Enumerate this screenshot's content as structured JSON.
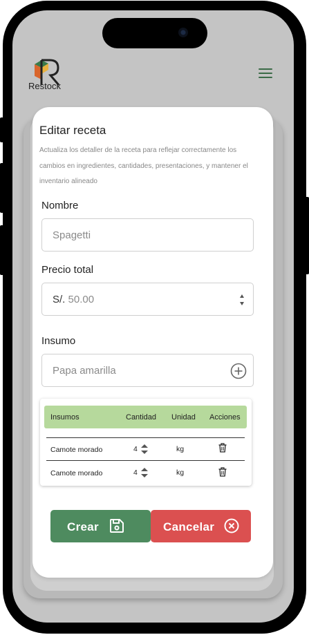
{
  "app": {
    "name": "Restock"
  },
  "form": {
    "title": "Editar receta",
    "description": "Actualiza los detaller de la receta para reflejar correctamente los cambios en ingredientes, cantidades, presentaciones, y mantener el inventario alineado",
    "name_label": "Nombre",
    "name_value": "Spagetti",
    "price_label": "Precio total",
    "price_prefix": "S/.",
    "price_value": "50.00",
    "supply_label": "Insumo",
    "supply_placeholder": "Papa amarilla"
  },
  "table": {
    "headers": {
      "supply": "Insumos",
      "quantity": "Cantidad",
      "unit": "Unidad",
      "actions": "Acciones"
    },
    "rows": [
      {
        "supply": "Camote morado",
        "quantity": "4",
        "unit": "kg"
      },
      {
        "supply": "Camote morado",
        "quantity": "4",
        "unit": "kg"
      }
    ]
  },
  "buttons": {
    "create": "Crear",
    "cancel": "Cancelar"
  },
  "colors": {
    "primary_green": "#4e8b5f",
    "header_green": "#b6d99c",
    "danger_red": "#db5050",
    "menu_green": "#3b6b47"
  },
  "icons": {
    "menu": "hamburger-icon",
    "add": "plus-circle-icon",
    "delete": "trash-icon",
    "save": "floppy-disk-icon",
    "cancel": "x-circle-icon"
  }
}
